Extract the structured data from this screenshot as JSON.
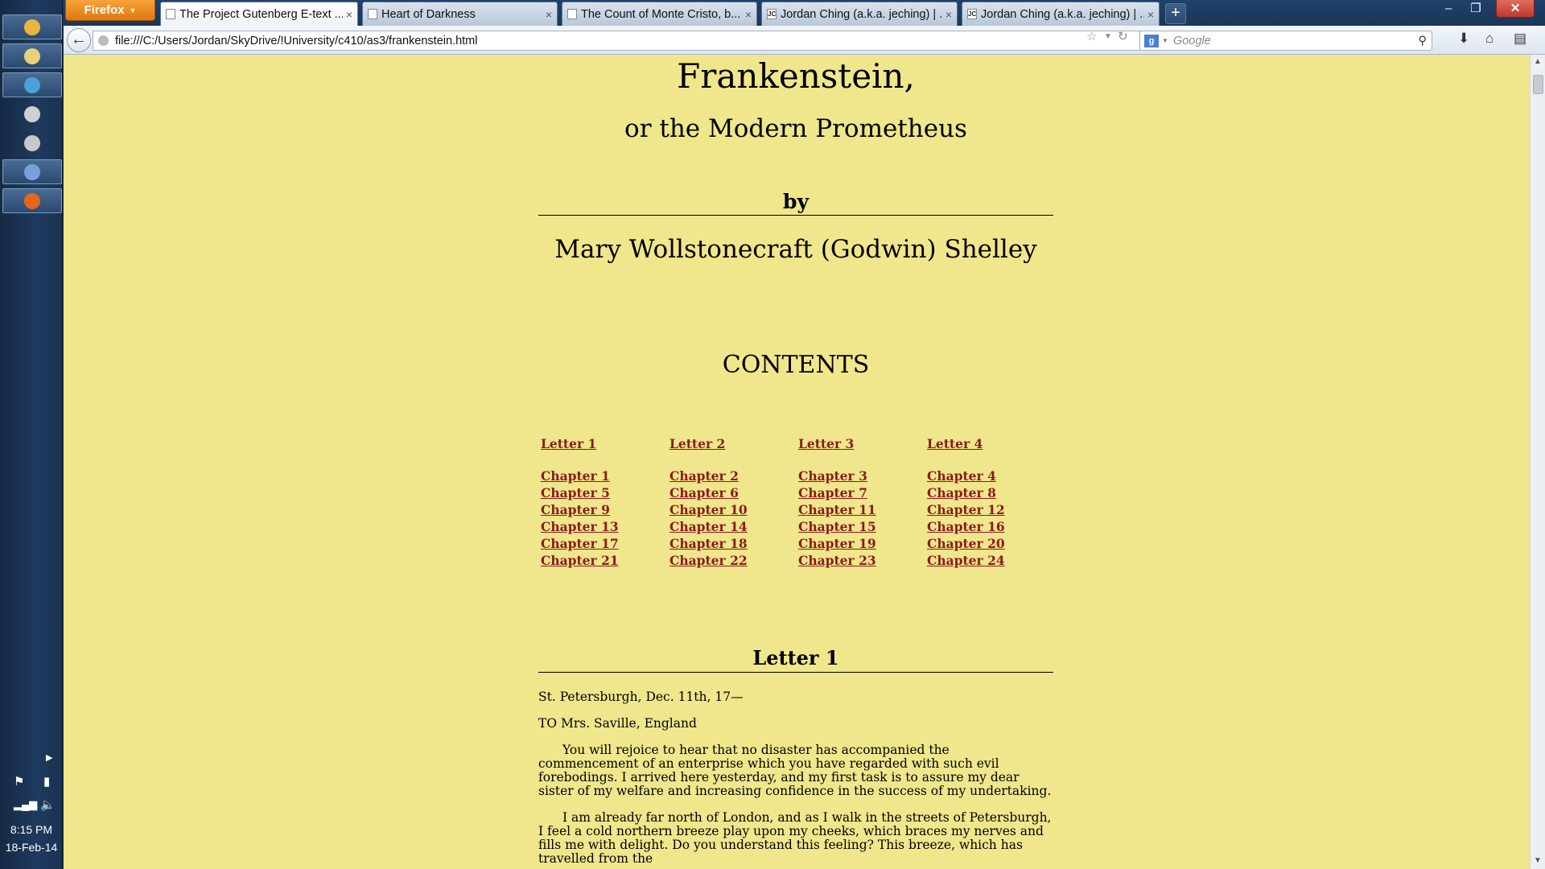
{
  "taskbar": {
    "apps": [
      {
        "name": "chrome-icon",
        "color": "#e8b63a"
      },
      {
        "name": "folder-icon",
        "color": "#e7d27a"
      },
      {
        "name": "app-icon",
        "color": "#4aa3d8"
      },
      {
        "name": "settings-icon",
        "color": "#d0d0d0"
      },
      {
        "name": "steam-icon",
        "color": "#c8c8c8"
      },
      {
        "name": "document-icon",
        "color": "#7aa0d8"
      },
      {
        "name": "firefox-icon",
        "color": "#e5661c"
      }
    ],
    "time": "8:15 PM",
    "date": "18-Feb-14"
  },
  "browser": {
    "menu_label": "Firefox",
    "tabs": [
      {
        "title": "The Project Gutenberg E-text ...",
        "favicon": "",
        "selected": true
      },
      {
        "title": "Heart of Darkness",
        "favicon": "",
        "selected": false
      },
      {
        "title": "The Count of Monte Cristo, b...",
        "favicon": "",
        "selected": false
      },
      {
        "title": "Jordan Ching (a.k.a. jeching) | ...",
        "favicon": "JC",
        "selected": false
      },
      {
        "title": "Jordan Ching (a.k.a. jeching) | ...",
        "favicon": "JC",
        "selected": false
      }
    ],
    "url": "file:///C:/Users/Jordan/SkyDrive/!University/c410/as3/frankenstein.html",
    "search_placeholder": "Google",
    "search_engine": "g"
  },
  "page": {
    "background": "#f0e68c",
    "link_color": "#8b1a1a",
    "title": "Frankenstein,",
    "subtitle": "or the Modern Prometheus",
    "by": "by",
    "author": "Mary Wollstonecraft (Godwin) Shelley",
    "contents_heading": "CONTENTS",
    "letters": [
      "Letter 1",
      "Letter 2",
      "Letter 3",
      "Letter 4"
    ],
    "chapters": [
      "Chapter 1",
      "Chapter 2",
      "Chapter 3",
      "Chapter 4",
      "Chapter 5",
      "Chapter 6",
      "Chapter 7",
      "Chapter 8",
      "Chapter 9",
      "Chapter 10",
      "Chapter 11",
      "Chapter 12",
      "Chapter 13",
      "Chapter 14",
      "Chapter 15",
      "Chapter 16",
      "Chapter 17",
      "Chapter 18",
      "Chapter 19",
      "Chapter 20",
      "Chapter 21",
      "Chapter 22",
      "Chapter 23",
      "Chapter 24"
    ],
    "letter1": {
      "heading": "Letter 1",
      "place_date": "St. Petersburgh, Dec. 11th, 17—",
      "addressee": "TO Mrs. Saville, England",
      "paragraphs": [
        "You will rejoice to hear that no disaster has accompanied the commencement of an enterprise which you have regarded with such evil forebodings. I arrived here yesterday, and my first task is to assure my dear sister of my welfare and increasing confidence in the success of my undertaking.",
        "I am already far north of London, and as I walk in the streets of Petersburgh, I feel a cold northern breeze play upon my cheeks, which braces my nerves and fills me with delight. Do you understand this feeling? This breeze, which has travelled from the"
      ]
    }
  }
}
